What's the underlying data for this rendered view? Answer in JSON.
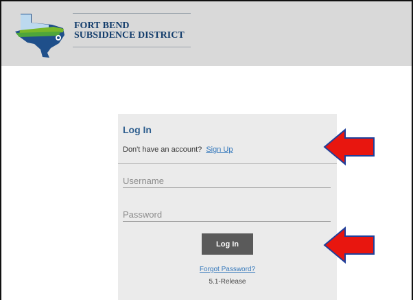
{
  "header": {
    "logo_line_1": "FORT BEND",
    "logo_line_2": "SUBSIDENCE DISTRICT"
  },
  "login": {
    "title": "Log In",
    "account_prompt": "Don't have an account?",
    "signup_link": "Sign Up",
    "username_placeholder": "Username",
    "password_placeholder": "Password",
    "button_label": "Log In",
    "forgot_link": "Forgot Password?",
    "version": "5.1-Release"
  },
  "colors": {
    "header_bg": "#d9d9d9",
    "card_bg": "#ebebeb",
    "title": "#2f5f8f",
    "link": "#3377bb",
    "button_bg": "#5a5a5a",
    "annotation_arrow": "#e8160f"
  },
  "annotations": {
    "arrows": [
      "arrow-left-icon",
      "arrow-left-icon"
    ]
  }
}
